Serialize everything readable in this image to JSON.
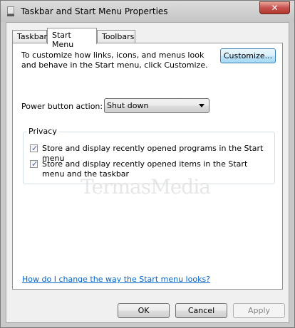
{
  "window": {
    "title": "Taskbar and Start Menu Properties",
    "close_glyph": "✕"
  },
  "tabs": [
    {
      "label": "Taskbar",
      "active": false
    },
    {
      "label": "Start Menu",
      "active": true
    },
    {
      "label": "Toolbars",
      "active": false
    }
  ],
  "start_menu": {
    "description": "To customize how links, icons, and menus look and behave in the Start menu, click Customize.",
    "customize_label": "Customize...",
    "power_label": "Power button action:",
    "power_value": "Shut down",
    "privacy": {
      "title": "Privacy",
      "items": [
        {
          "label": "Store and display recently opened programs in the Start menu",
          "checked": true
        },
        {
          "label": "Store and display recently opened items in the Start menu and the taskbar",
          "checked": true
        }
      ]
    },
    "help_link": "How do I change the way the Start menu looks?"
  },
  "watermark": "TermasMedia",
  "buttons": {
    "ok": "OK",
    "cancel": "Cancel",
    "apply": "Apply"
  },
  "colors": {
    "link": "#0066cc",
    "close_button": "#c75050",
    "focus_border": "#3c7fb1"
  },
  "icons": [
    "app-icon",
    "close-icon",
    "dropdown-arrow-icon",
    "checkmark-icon"
  ]
}
